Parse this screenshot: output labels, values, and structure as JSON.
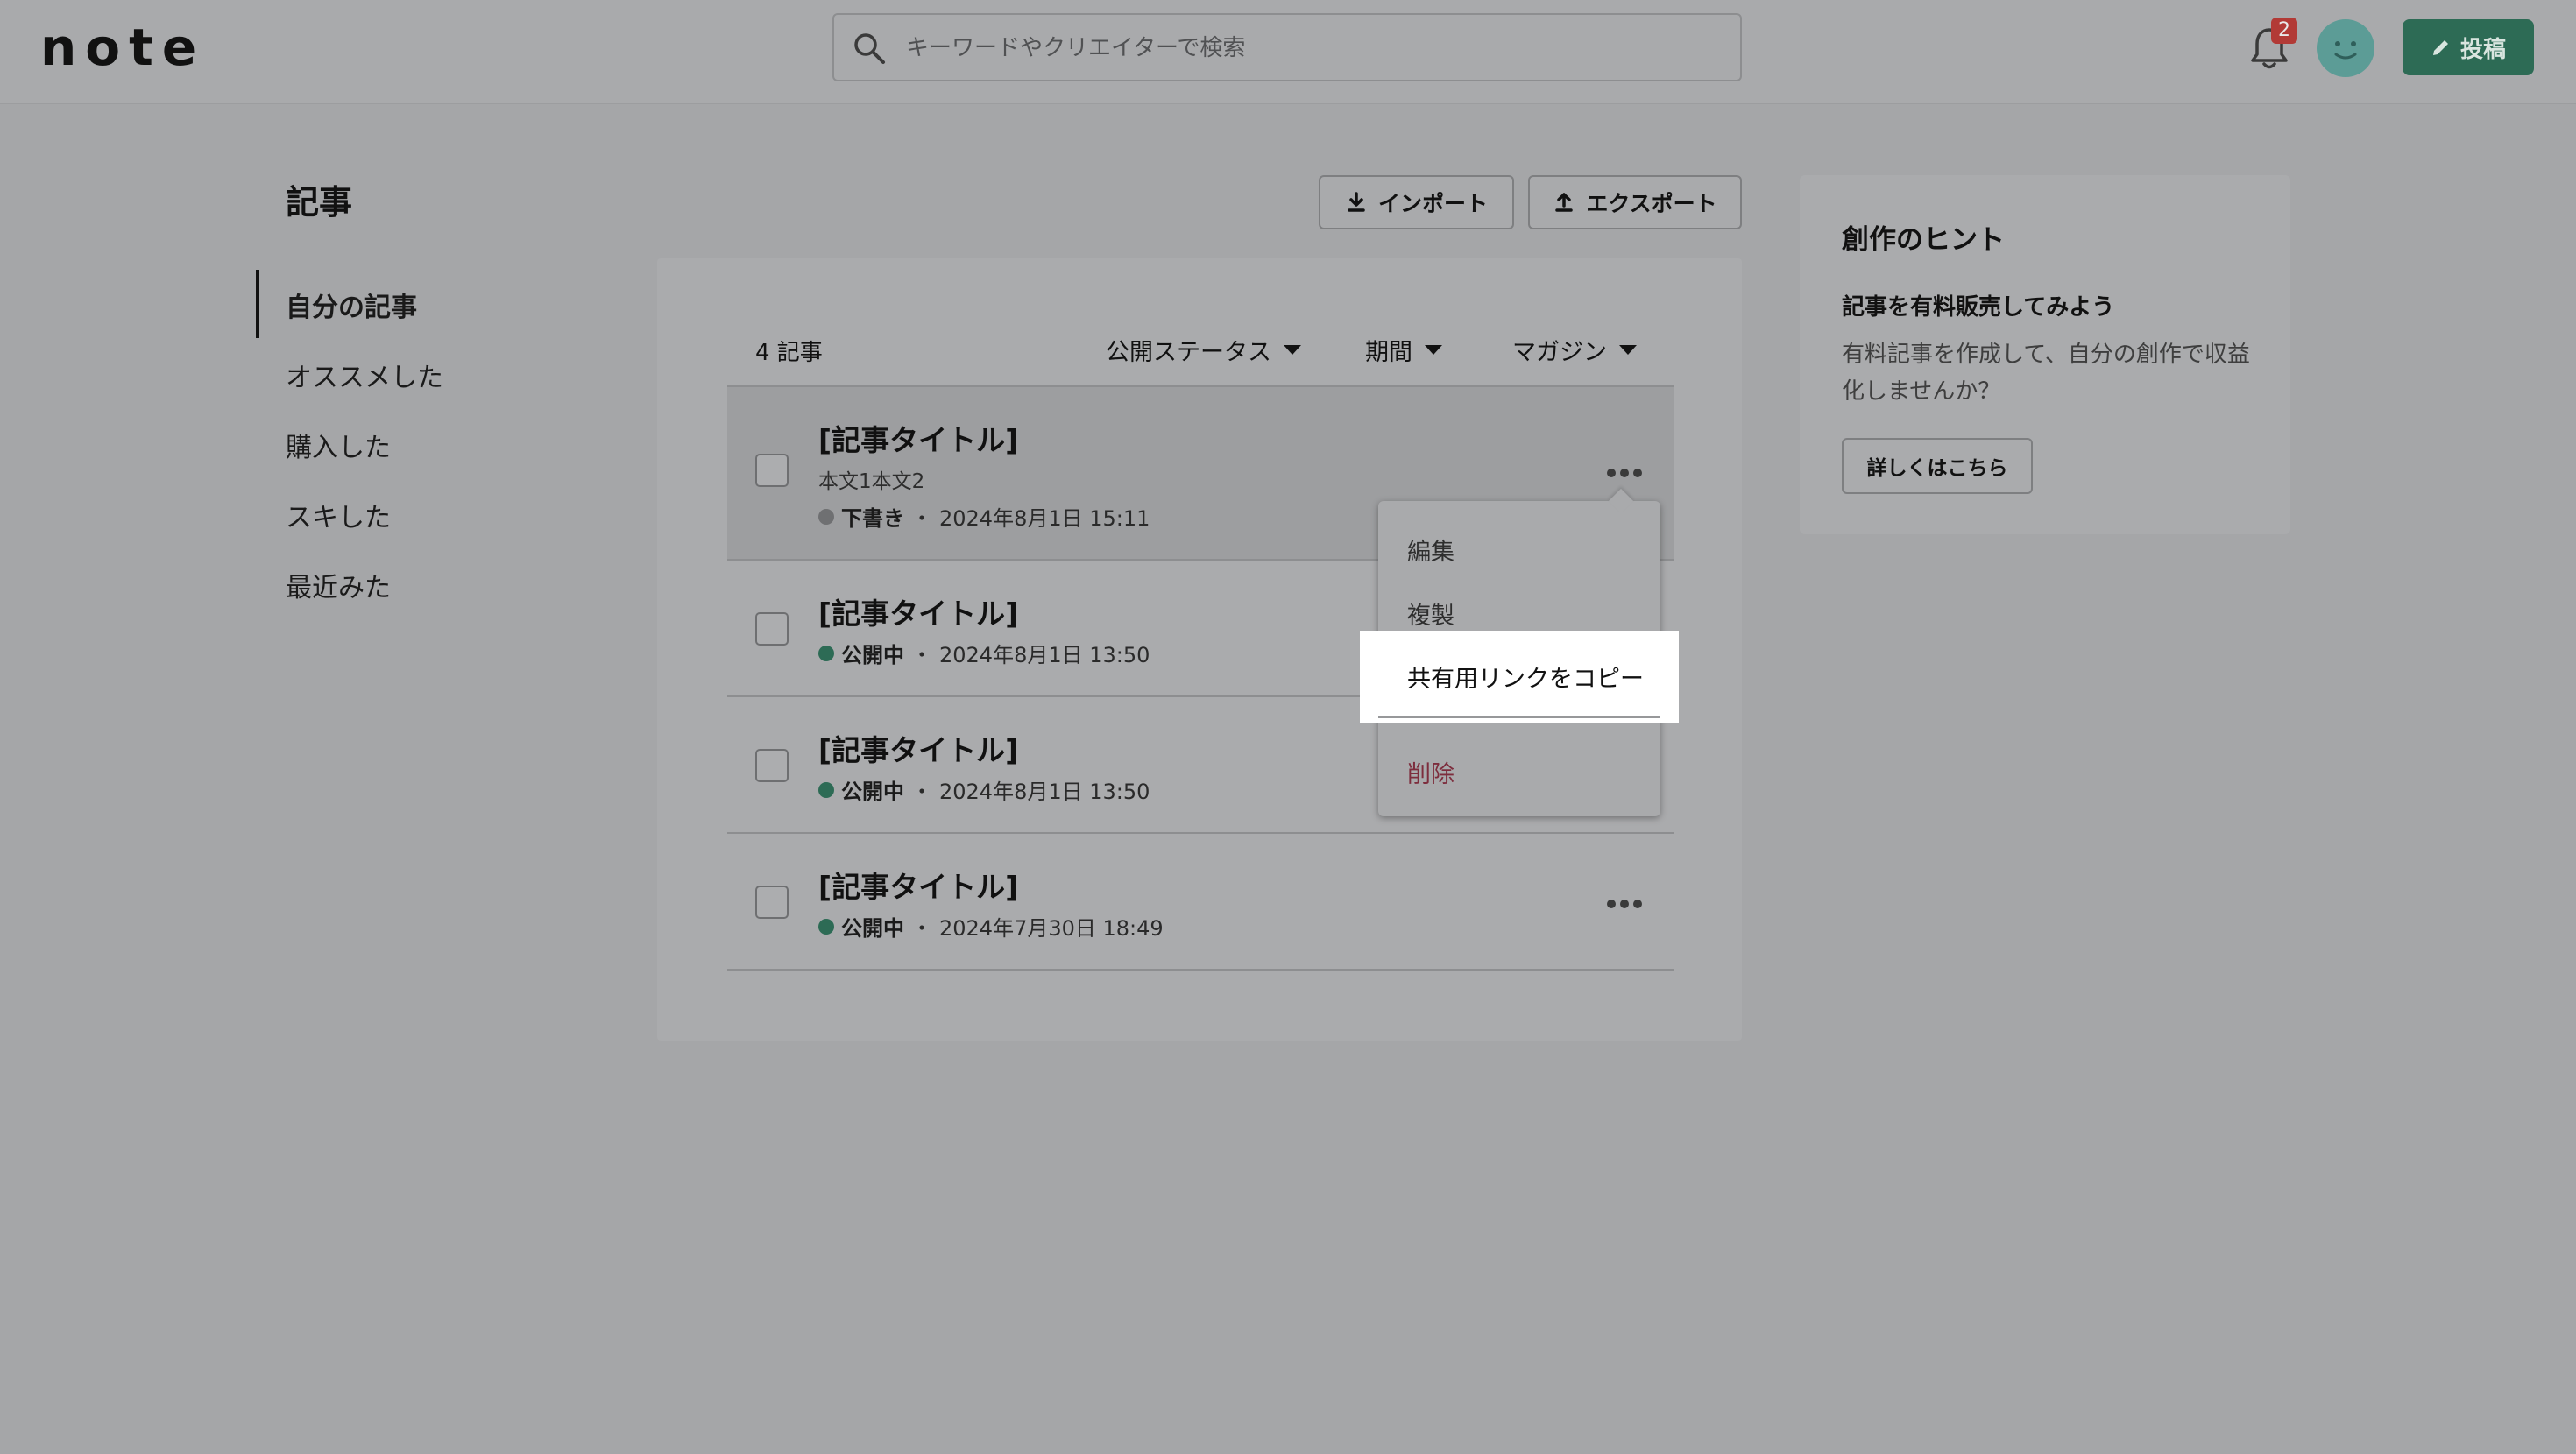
{
  "header": {
    "logo": "note",
    "search_placeholder": "キーワードやクリエイターで検索",
    "notification_count": "2",
    "post_button": "投稿"
  },
  "sidebar": {
    "title": "記事",
    "items": [
      {
        "label": "自分の記事",
        "active": true
      },
      {
        "label": "オススメした"
      },
      {
        "label": "購入した"
      },
      {
        "label": "スキした"
      },
      {
        "label": "最近みた"
      }
    ]
  },
  "toolbar": {
    "import_label": "インポート",
    "export_label": "エクスポート"
  },
  "list": {
    "count": "4 記事",
    "filters": [
      "公開ステータス",
      "期間",
      "マガジン"
    ],
    "separator": "・",
    "articles": [
      {
        "title": "[記事タイトル]",
        "body": "本文1本文2",
        "status": "下書き",
        "date": "2024年8月1日 15:11"
      },
      {
        "title": "[記事タイトル]",
        "status": "公開中",
        "date": "2024年8月1日 13:50"
      },
      {
        "title": "[記事タイトル]",
        "status": "公開中",
        "date": "2024年8月1日 13:50"
      },
      {
        "title": "[記事タイトル]",
        "status": "公開中",
        "date": "2024年7月30日 18:49"
      }
    ]
  },
  "context_menu": {
    "items": [
      "編集",
      "複製",
      "共有用リンクをコピー",
      "削除"
    ]
  },
  "hint": {
    "title": "創作のヒント",
    "subtitle": "記事を有料販売してみよう",
    "text": "有料記事を作成して、自分の創作で収益化しませんか？",
    "button": "詳しくはこちら"
  }
}
